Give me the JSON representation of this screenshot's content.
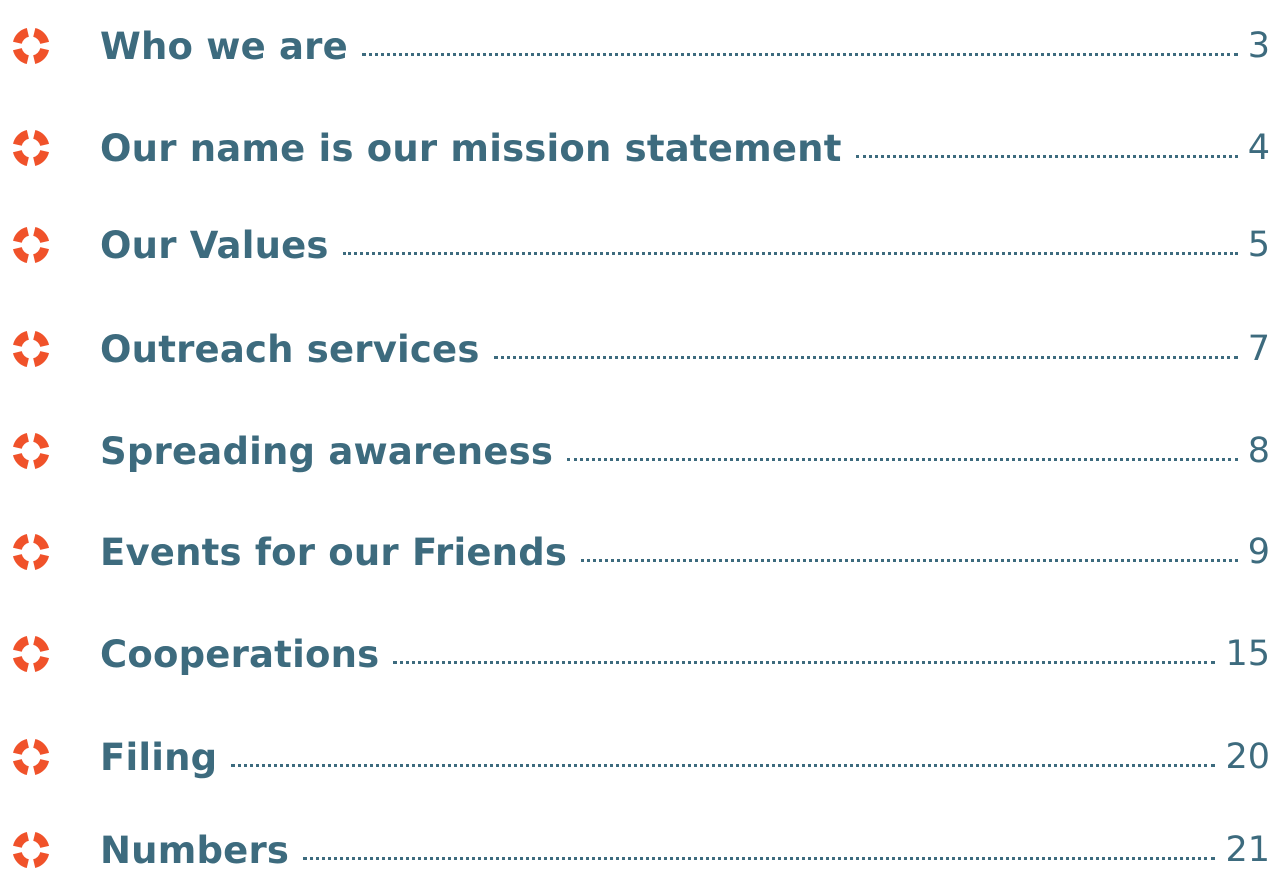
{
  "colors": {
    "heading": "#3d6b7e",
    "icon_accent": "#f0522a"
  },
  "toc": {
    "entries": [
      {
        "title": "Who we are",
        "page": "3",
        "icon": "lifebuoy-icon"
      },
      {
        "title": "Our name is our mission statement",
        "page": "4",
        "icon": "lifebuoy-icon"
      },
      {
        "title": "Our Values",
        "page": "5",
        "icon": "lifebuoy-icon"
      },
      {
        "title": "Outreach services",
        "page": "7",
        "icon": "lifebuoy-icon"
      },
      {
        "title": "Spreading awareness",
        "page": "8",
        "icon": "lifebuoy-icon"
      },
      {
        "title": "Events for our Friends",
        "page": "9",
        "icon": "lifebuoy-icon"
      },
      {
        "title": "Cooperations",
        "page": "15",
        "icon": "lifebuoy-icon"
      },
      {
        "title": "Filing",
        "page": "20",
        "icon": "lifebuoy-icon"
      },
      {
        "title": "Numbers",
        "page": "21",
        "icon": "lifebuoy-icon"
      }
    ]
  }
}
